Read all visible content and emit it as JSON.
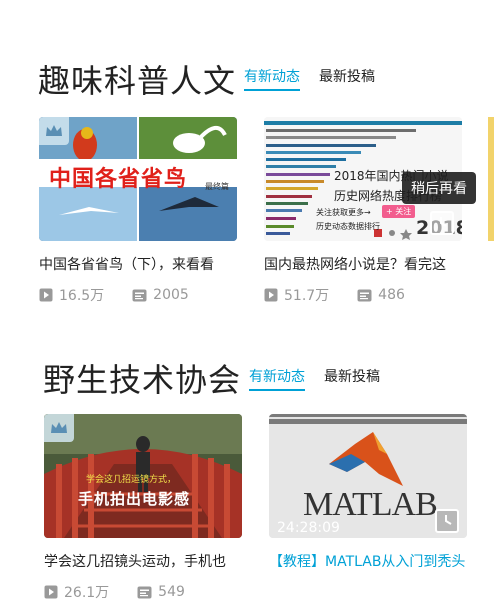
{
  "sections": [
    {
      "title": "趣味科普人文",
      "tabs": [
        "有新动态",
        "最新投稿"
      ],
      "cards": [
        {
          "thumb_text": "中国各省省鸟",
          "thumb_subtext": "最终篇",
          "title": "中国各省省鸟（下），来看看",
          "plays": "16.5万",
          "danmaku": "2005"
        },
        {
          "thumb_text_1": "2018年国内热门小说",
          "thumb_text_2": "历史网络热度排行榜",
          "thumb_follow": "关注获取更多→",
          "thumb_follow_btn": "+ 关注",
          "thumb_source": "历史动态数据排行",
          "thumb_year": "2018",
          "tooltip": "稍后再看",
          "title": "国内最热网络小说是？看完这",
          "plays": "51.7万",
          "danmaku": "486"
        }
      ]
    },
    {
      "title": "野生技术协会",
      "tabs": [
        "有新动态",
        "最新投稿"
      ],
      "cards": [
        {
          "thumb_text_1": "学会这几招运镜方式，",
          "thumb_text_2": "手机拍出电影感",
          "title": "学会这几招镜头运动，手机也",
          "plays": "26.1万",
          "danmaku": "549"
        },
        {
          "thumb_logo": "MATLAB",
          "duration": "24:28:09",
          "title": "【教程】MATLAB从入门到秃头"
        }
      ]
    }
  ],
  "colors": {
    "accent": "#00a1d6",
    "text": "#222222",
    "muted": "#999999"
  }
}
